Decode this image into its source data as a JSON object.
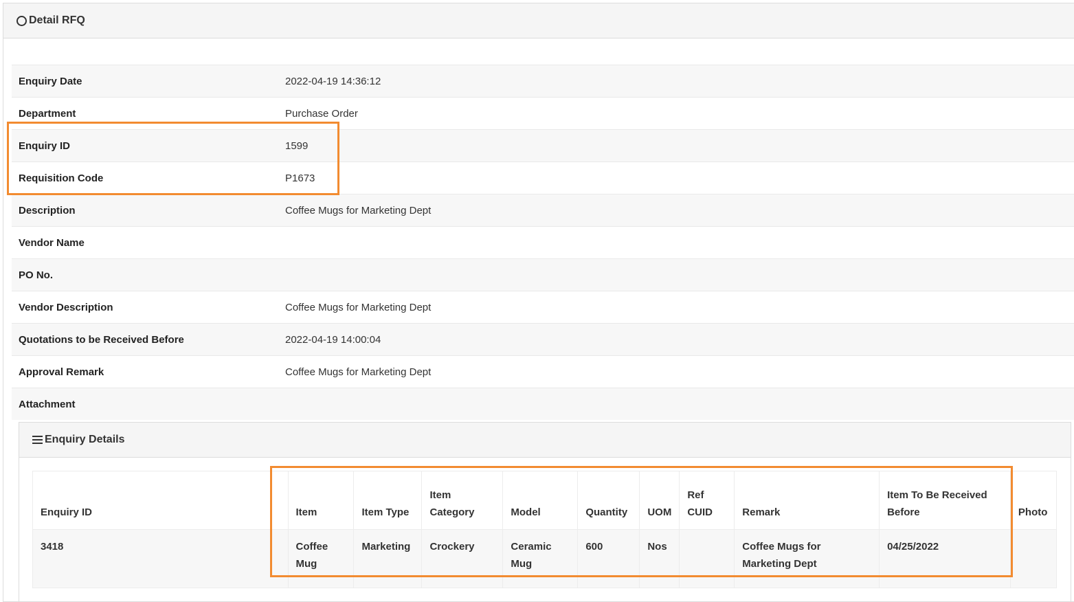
{
  "card": {
    "title": "Detail RFQ"
  },
  "details": [
    {
      "label": "Enquiry Date",
      "value": "2022-04-19 14:36:12"
    },
    {
      "label": "Department",
      "value": "Purchase Order"
    },
    {
      "label": "Enquiry ID",
      "value": "1599"
    },
    {
      "label": "Requisition Code",
      "value": "P1673"
    },
    {
      "label": "Description",
      "value": "Coffee Mugs for Marketing Dept"
    },
    {
      "label": "Vendor Name",
      "value": ""
    },
    {
      "label": "PO No.",
      "value": ""
    },
    {
      "label": "Vendor Description",
      "value": "Coffee Mugs for Marketing Dept"
    },
    {
      "label": "Quotations to be Received Before",
      "value": "2022-04-19 14:00:04"
    },
    {
      "label": "Approval Remark",
      "value": "Coffee Mugs for Marketing Dept"
    },
    {
      "label": "Attachment",
      "value": ""
    }
  ],
  "enquiry_details": {
    "title": "Enquiry Details",
    "columns": [
      "Enquiry ID",
      "Item",
      "Item Type",
      "Item Category",
      "Model",
      "Quantity",
      "UOM",
      "Ref CUID",
      "Remark",
      "Item To Be Received Before",
      "Photo"
    ],
    "rows": [
      [
        "3418",
        "Coffee Mug",
        "Marketing",
        "Crockery",
        "Ceramic Mug",
        "600",
        "Nos",
        "",
        "Coffee Mugs for Marketing Dept",
        "04/25/2022",
        ""
      ]
    ]
  },
  "colors": {
    "highlight": "#f28b30",
    "header_bg": "#f5f5f5",
    "stripe_bg": "#f7f7f7"
  }
}
